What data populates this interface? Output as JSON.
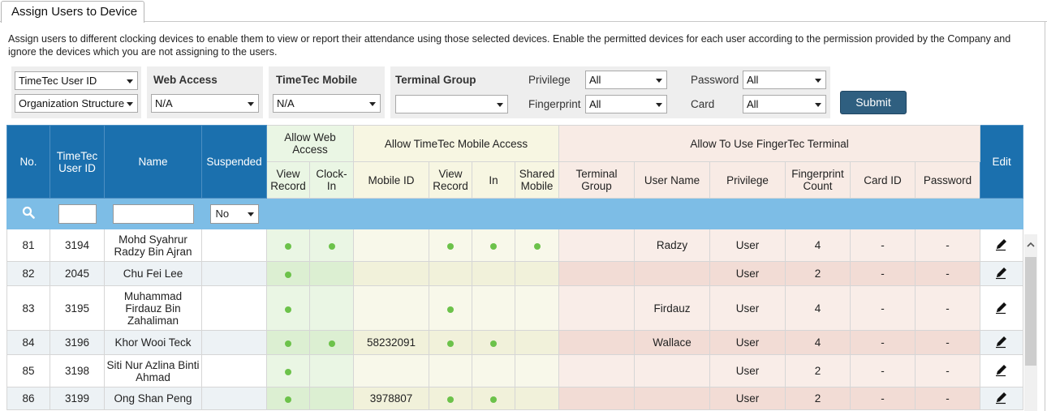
{
  "tab": {
    "title": "Assign Users to Device"
  },
  "description": "Assign users to different clocking devices to enable them to view or report their attendance using those selected devices. Enable the permitted devices for each user according to the permission provided by the Company and ignore the devices which you are not assigning to the users.",
  "filters": {
    "id_type": "TimeTec User ID",
    "structure": "Organization Structure",
    "web_access": {
      "label": "Web Access",
      "value": "N/A"
    },
    "mobile": {
      "label": "TimeTec Mobile",
      "value": "N/A"
    },
    "terminal_group": {
      "label": "Terminal Group",
      "value": ""
    },
    "privilege": {
      "label": "Privilege",
      "value": "All"
    },
    "fingerprint": {
      "label": "Fingerprint",
      "value": "All"
    },
    "password": {
      "label": "Password",
      "value": "All"
    },
    "card": {
      "label": "Card",
      "value": "All"
    },
    "submit_label": "Submit"
  },
  "table": {
    "headers": {
      "no": "No.",
      "user_id": "TimeTec User ID",
      "name": "Name",
      "suspended": "Suspended",
      "web_group": "Allow Web Access",
      "mobile_group": "Allow TimeTec Mobile Access",
      "terminal_group": "Allow To Use FingerTec Terminal",
      "edit": "Edit",
      "view_record": "View Record",
      "clock_in": "Clock-In",
      "mobile_id": "Mobile ID",
      "mobile_view_record": "View Record",
      "in": "In",
      "shared_mobile": "Shared Mobile",
      "terminal_group_col": "Terminal Group",
      "user_name": "User Name",
      "privilege": "Privilege",
      "fingerprint_count": "Fingerprint Count",
      "card_id": "Card ID",
      "password": "Password"
    },
    "search": {
      "suspended_value": "No"
    },
    "rows": [
      {
        "no": "81",
        "id": "3194",
        "name": "Mohd Syahrur Radzy Bin Ajran",
        "web_view": true,
        "web_clock": true,
        "mobile_id": "",
        "mob_view": true,
        "mob_in": true,
        "mob_shared": true,
        "user_name": "Radzy",
        "privilege": "User",
        "fp": "4",
        "card": "-",
        "pwd": "-"
      },
      {
        "no": "82",
        "id": "2045",
        "name": "Chu Fei Lee",
        "web_view": true,
        "web_clock": false,
        "mobile_id": "",
        "mob_view": false,
        "mob_in": false,
        "mob_shared": false,
        "user_name": "",
        "privilege": "User",
        "fp": "2",
        "card": "-",
        "pwd": "-"
      },
      {
        "no": "83",
        "id": "3195",
        "name": "Muhammad Firdauz Bin Zahaliman",
        "web_view": true,
        "web_clock": false,
        "mobile_id": "",
        "mob_view": true,
        "mob_in": false,
        "mob_shared": false,
        "user_name": "Firdauz",
        "privilege": "User",
        "fp": "4",
        "card": "-",
        "pwd": "-"
      },
      {
        "no": "84",
        "id": "3196",
        "name": "Khor Wooi Teck",
        "web_view": true,
        "web_clock": true,
        "mobile_id": "58232091",
        "mob_view": true,
        "mob_in": true,
        "mob_shared": false,
        "user_name": "Wallace",
        "privilege": "User",
        "fp": "4",
        "card": "-",
        "pwd": "-"
      },
      {
        "no": "85",
        "id": "3198",
        "name": "Siti Nur Azlina Binti Ahmad",
        "web_view": true,
        "web_clock": false,
        "mobile_id": "",
        "mob_view": false,
        "mob_in": false,
        "mob_shared": false,
        "user_name": "",
        "privilege": "User",
        "fp": "2",
        "card": "-",
        "pwd": "-"
      },
      {
        "no": "86",
        "id": "3199",
        "name": "Ong Shan Peng",
        "web_view": true,
        "web_clock": false,
        "mobile_id": "3978807",
        "mob_view": true,
        "mob_in": true,
        "mob_shared": false,
        "user_name": "",
        "privilege": "User",
        "fp": "2",
        "card": "-",
        "pwd": "-"
      }
    ]
  },
  "icons": {
    "search": "search-icon",
    "edit": "pencil-icon",
    "scroll_up": "chevron-up-icon"
  },
  "colors": {
    "header_blue": "#1b70ae",
    "search_row": "#7dbde6",
    "active_dot": "#6cc24a",
    "submit": "#2f5f80"
  }
}
